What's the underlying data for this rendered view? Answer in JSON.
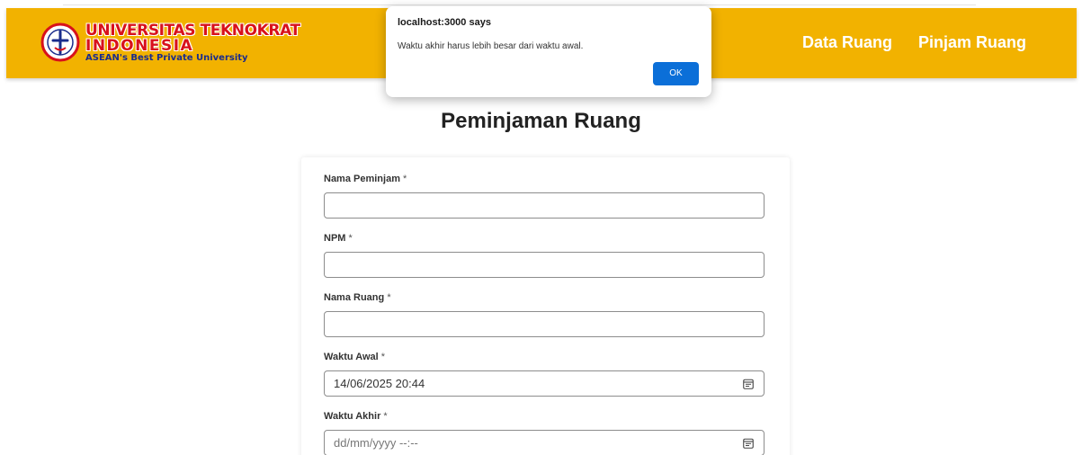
{
  "navbar": {
    "background_color": "#f2b200",
    "logo": {
      "line1": "UNIVERSITAS TEKNOKRAT",
      "line2": "INDONESIA",
      "line3": "ASEAN's Best Private University",
      "emblem_icon": "university-emblem-icon"
    },
    "links": [
      {
        "label": "Data Ruang"
      },
      {
        "label": "Pinjam Ruang"
      }
    ]
  },
  "page": {
    "title": "Peminjaman Ruang"
  },
  "form": {
    "required_marker": "*",
    "fields": [
      {
        "label": "Nama Peminjam",
        "value": "",
        "placeholder": ""
      },
      {
        "label": "NPM",
        "value": "",
        "placeholder": ""
      },
      {
        "label": "Nama Ruang",
        "value": "",
        "placeholder": ""
      },
      {
        "label": "Waktu Awal",
        "value": "14/06/2025 20:44",
        "icon": "calendar-icon"
      },
      {
        "label": "Waktu Akhir",
        "placeholder": "dd/mm/yyyy --:--",
        "icon": "calendar-icon"
      }
    ]
  },
  "alert": {
    "title": "localhost:3000 says",
    "message": "Waktu akhir harus lebih besar dari waktu awal.",
    "ok_label": "OK",
    "ok_color": "#0b6fd8"
  }
}
